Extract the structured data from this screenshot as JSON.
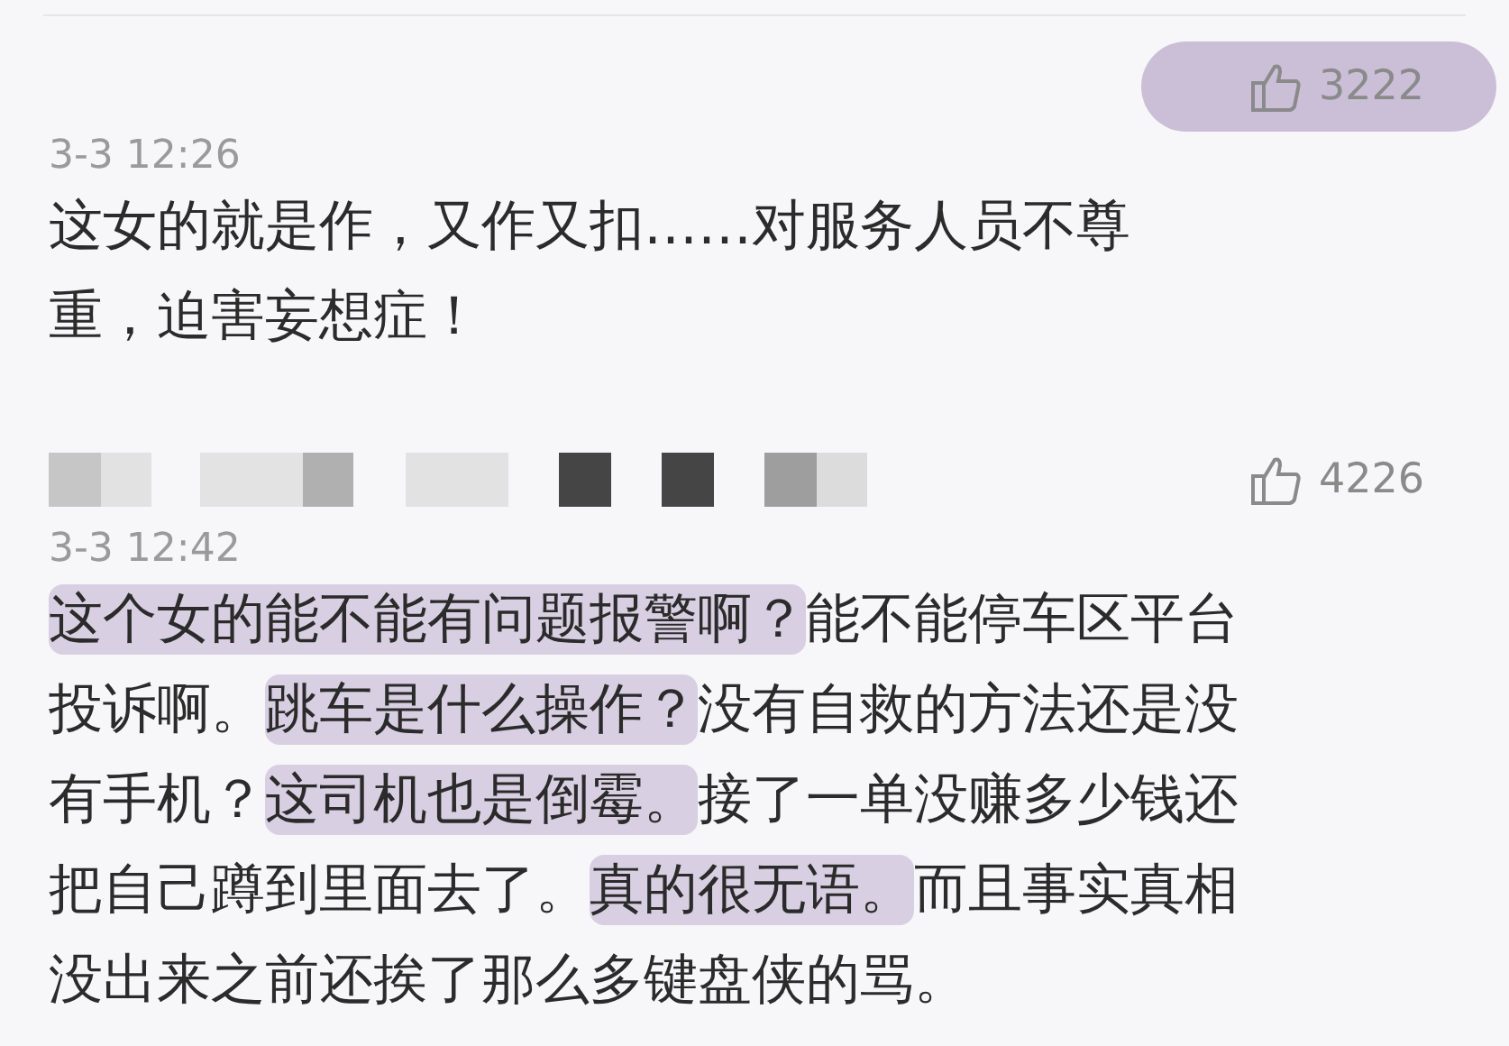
{
  "comments": [
    {
      "likes": "3222",
      "likes_highlighted": true,
      "time": "3-3 12:26",
      "segments": [
        {
          "text": "这女的就是作，又作又扣……对服务人员不尊重，迫害妄想症！",
          "highlighted": false
        }
      ]
    },
    {
      "likes": "4226",
      "likes_highlighted": false,
      "username_pixelated": true,
      "time": "3-3 12:42",
      "segments": [
        {
          "text": "这个女的能不能有问题报警啊？",
          "highlighted": true
        },
        {
          "text": "能不能停车区平台投诉啊。",
          "highlighted": false
        },
        {
          "text": "跳车是什么操作？",
          "highlighted": true
        },
        {
          "text": "没有自救的方法还是没有手机？",
          "highlighted": false
        },
        {
          "text": "这司机也是倒霉。",
          "highlighted": true
        },
        {
          "text": "接了一单没赚多少钱还把自己蹲到里面去了。",
          "highlighted": false
        },
        {
          "text": "真的很无语。",
          "highlighted": true
        },
        {
          "text": "而且事实真相没出来之前还挨了那么多键盘侠的骂。",
          "highlighted": false
        }
      ]
    }
  ]
}
